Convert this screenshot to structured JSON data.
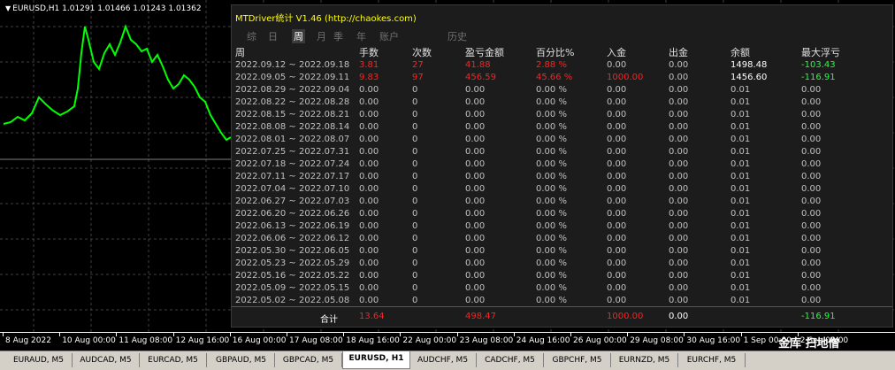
{
  "chart": {
    "header": "EURUSD,H1  1.01291 1.01466 1.01243 1.01362",
    "line_color": "#00ff00",
    "grid_color": "#404040",
    "time_labels": [
      "8 Aug 2022",
      "10 Aug 00:00",
      "11 Aug 08:00",
      "12 Aug 16:00",
      "16 Aug 00:00",
      "17 Aug 08:00",
      "18 Aug 16:00",
      "22 Aug 00:00",
      "23 Aug 08:00",
      "24 Aug 16:00",
      "26 Aug 00:00",
      "29 Aug 08:00",
      "30 Aug 16:00",
      "1 Sep 00:00",
      "2 Sep 08:00"
    ]
  },
  "tabs": [
    "EURAUD, M5",
    "AUDCAD, M5",
    "EURCAD, M5",
    "GBPAUD, M5",
    "GBPCAD, M5",
    "EURUSD, H1",
    "AUDCHF, M5",
    "CADCHF, M5",
    "GBPCHF, M5",
    "EURNZD, M5",
    "EURCHF, M5"
  ],
  "active_tab": "EURUSD, H1",
  "panel": {
    "title": "MTDriver统计 V1.46  (http://chaokes.com)",
    "nav": [
      "综",
      "日",
      "周",
      "月",
      "季",
      "年",
      "账户",
      "历史"
    ],
    "active_nav": "周",
    "headers": [
      "周",
      "手数",
      "次数",
      "盈亏金额",
      "百分比%",
      "入金",
      "出金",
      "余额",
      "最大浮亏"
    ],
    "rows": [
      [
        "2022.09.12 ~ 2022.09.18",
        "3.81",
        "27",
        "41.88",
        "2.88 %",
        "0.00",
        "0.00",
        "1498.48",
        "-103.43"
      ],
      [
        "2022.09.05 ~ 2022.09.11",
        "9.83",
        "97",
        "456.59",
        "45.66 %",
        "1000.00",
        "0.00",
        "1456.60",
        "-116.91"
      ],
      [
        "2022.08.29 ~ 2022.09.04",
        "0.00",
        "0",
        "0.00",
        "0.00 %",
        "0.00",
        "0.00",
        "0.01",
        "0.00"
      ],
      [
        "2022.08.22 ~ 2022.08.28",
        "0.00",
        "0",
        "0.00",
        "0.00 %",
        "0.00",
        "0.00",
        "0.01",
        "0.00"
      ],
      [
        "2022.08.15 ~ 2022.08.21",
        "0.00",
        "0",
        "0.00",
        "0.00 %",
        "0.00",
        "0.00",
        "0.01",
        "0.00"
      ],
      [
        "2022.08.08 ~ 2022.08.14",
        "0.00",
        "0",
        "0.00",
        "0.00 %",
        "0.00",
        "0.00",
        "0.01",
        "0.00"
      ],
      [
        "2022.08.01 ~ 2022.08.07",
        "0.00",
        "0",
        "0.00",
        "0.00 %",
        "0.00",
        "0.00",
        "0.01",
        "0.00"
      ],
      [
        "2022.07.25 ~ 2022.07.31",
        "0.00",
        "0",
        "0.00",
        "0.00 %",
        "0.00",
        "0.00",
        "0.01",
        "0.00"
      ],
      [
        "2022.07.18 ~ 2022.07.24",
        "0.00",
        "0",
        "0.00",
        "0.00 %",
        "0.00",
        "0.00",
        "0.01",
        "0.00"
      ],
      [
        "2022.07.11 ~ 2022.07.17",
        "0.00",
        "0",
        "0.00",
        "0.00 %",
        "0.00",
        "0.00",
        "0.01",
        "0.00"
      ],
      [
        "2022.07.04 ~ 2022.07.10",
        "0.00",
        "0",
        "0.00",
        "0.00 %",
        "0.00",
        "0.00",
        "0.01",
        "0.00"
      ],
      [
        "2022.06.27 ~ 2022.07.03",
        "0.00",
        "0",
        "0.00",
        "0.00 %",
        "0.00",
        "0.00",
        "0.01",
        "0.00"
      ],
      [
        "2022.06.20 ~ 2022.06.26",
        "0.00",
        "0",
        "0.00",
        "0.00 %",
        "0.00",
        "0.00",
        "0.01",
        "0.00"
      ],
      [
        "2022.06.13 ~ 2022.06.19",
        "0.00",
        "0",
        "0.00",
        "0.00 %",
        "0.00",
        "0.00",
        "0.01",
        "0.00"
      ],
      [
        "2022.06.06 ~ 2022.06.12",
        "0.00",
        "0",
        "0.00",
        "0.00 %",
        "0.00",
        "0.00",
        "0.01",
        "0.00"
      ],
      [
        "2022.05.30 ~ 2022.06.05",
        "0.00",
        "0",
        "0.00",
        "0.00 %",
        "0.00",
        "0.00",
        "0.01",
        "0.00"
      ],
      [
        "2022.05.23 ~ 2022.05.29",
        "0.00",
        "0",
        "0.00",
        "0.00 %",
        "0.00",
        "0.00",
        "0.01",
        "0.00"
      ],
      [
        "2022.05.16 ~ 2022.05.22",
        "0.00",
        "0",
        "0.00",
        "0.00 %",
        "0.00",
        "0.00",
        "0.01",
        "0.00"
      ],
      [
        "2022.05.09 ~ 2022.05.15",
        "0.00",
        "0",
        "0.00",
        "0.00 %",
        "0.00",
        "0.00",
        "0.01",
        "0.00"
      ],
      [
        "2022.05.02 ~ 2022.05.08",
        "0.00",
        "0",
        "0.00",
        "0.00 %",
        "0.00",
        "0.00",
        "0.01",
        "0.00"
      ]
    ],
    "totals": {
      "label": "合计",
      "lots": "13.64",
      "profit": "498.47",
      "deposit": "1000.00",
      "withdraw": "0.00",
      "max_float": "-116.91"
    },
    "colors": {
      "negative": "#ff2020",
      "positive": "#20ff40",
      "title": "#ffff00"
    }
  },
  "watermark": "金库 扫地僧"
}
